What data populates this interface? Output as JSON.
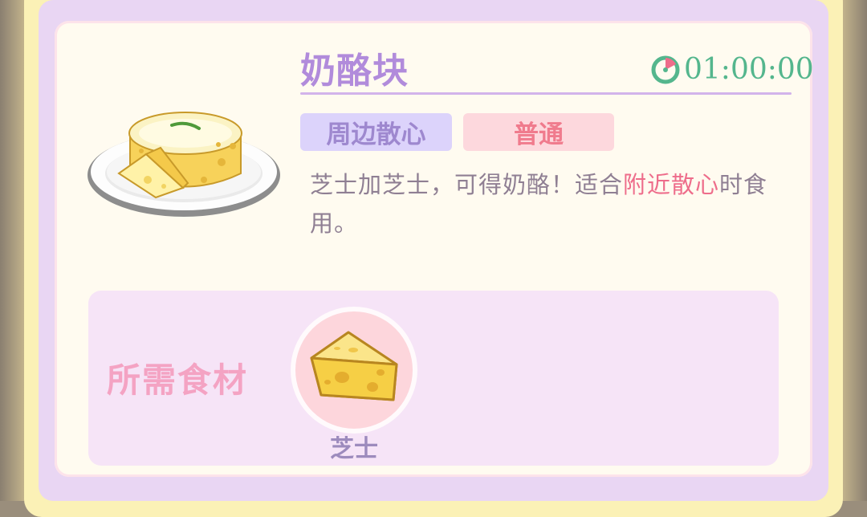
{
  "recipe": {
    "name": "奶酪块",
    "timer": "01:00:00",
    "category": "周边散心",
    "rarity": "普通",
    "description": {
      "part1": "芝士加芝士，可得奶酪！适合",
      "highlight": "附近散心",
      "part2": "时食用。"
    }
  },
  "ingredients": {
    "label": "所需食材",
    "items": [
      {
        "name": "芝士",
        "icon": "cheese-wedge-icon"
      }
    ]
  },
  "icons": {
    "dish": "cheese-block-plate-icon",
    "timer": "clock-icon"
  },
  "colors": {
    "title": "#b18bdb",
    "timer": "#54b68d",
    "highlight": "#ee6d8b",
    "tag_category_bg": "#dcd3fb",
    "tag_rarity_bg": "#fdd8dd"
  }
}
